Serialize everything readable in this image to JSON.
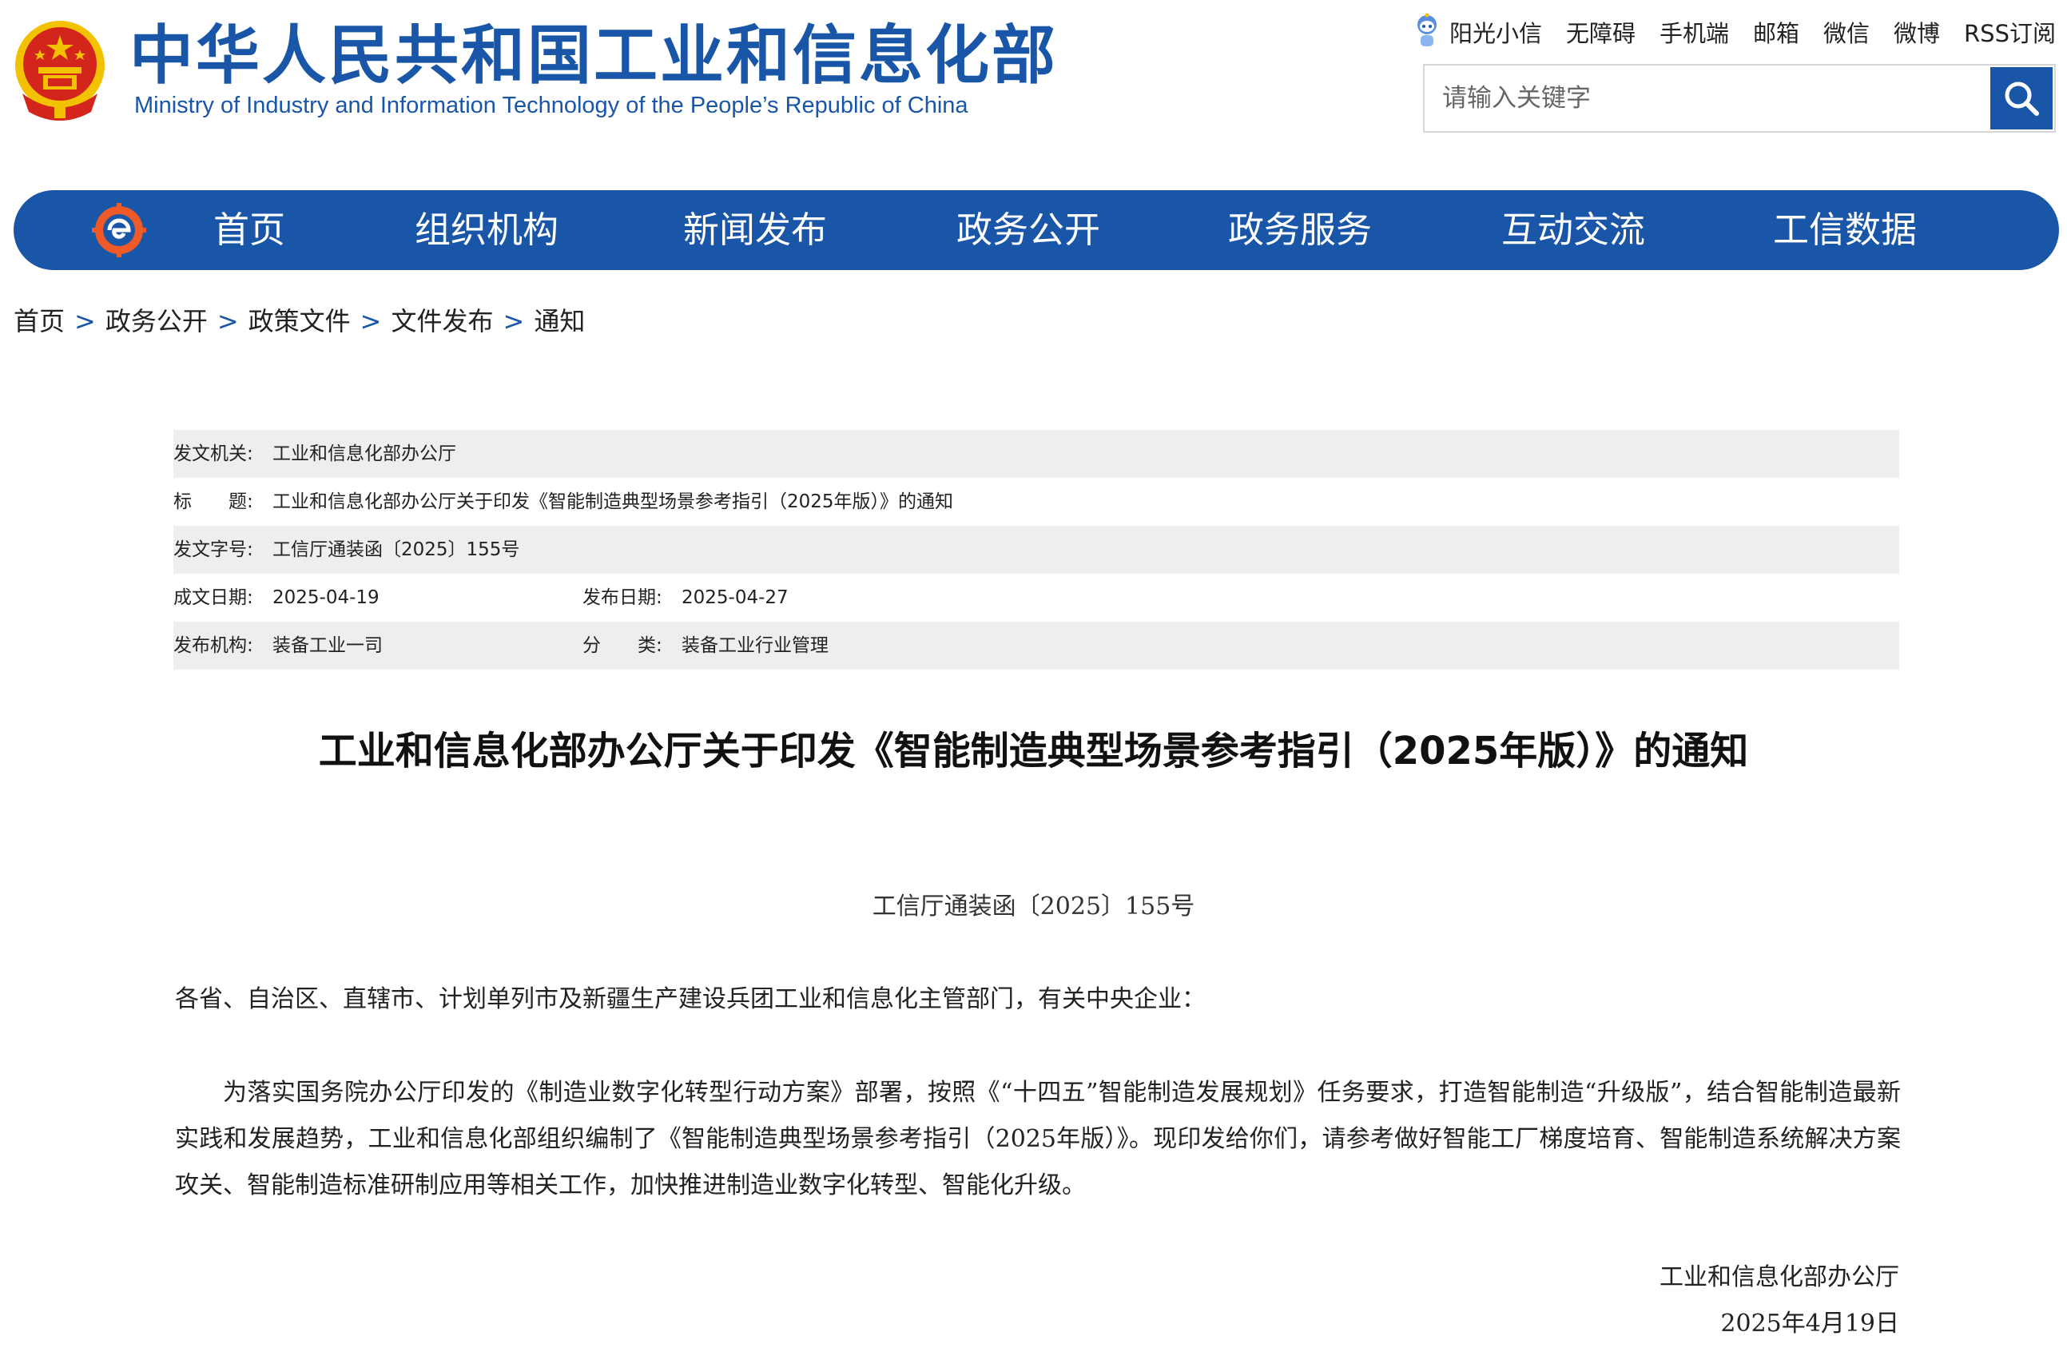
{
  "header": {
    "title_cn": "中华人民共和国工业和信息化部",
    "title_en": "Ministry of Industry and Information Technology of the People’s Republic of China",
    "top_links": [
      "阳光小信",
      "无障碍",
      "手机端",
      "邮箱",
      "微信",
      "微博",
      "RSS订阅"
    ],
    "search_placeholder": "请输入关键字"
  },
  "nav": {
    "items": [
      "首页",
      "组织机构",
      "新闻发布",
      "政务公开",
      "政务服务",
      "互动交流",
      "工信数据"
    ]
  },
  "breadcrumb": {
    "items": [
      "首页",
      "政务公开",
      "政策文件",
      "文件发布",
      "通知"
    ],
    "separator": ">"
  },
  "info": {
    "issuer_label": "发文机关:",
    "issuer": "工业和信息化部办公厅",
    "title_label": "标　　题:",
    "title": "工业和信息化部办公厅关于印发《智能制造典型场景参考指引（2025年版）》的通知",
    "doc_no_label": "发文字号:",
    "doc_no": "工信厅通装函〔2025〕155号",
    "created_label": "成文日期:",
    "created": "2025-04-19",
    "published_label": "发布日期:",
    "published": "2025-04-27",
    "org_label": "发布机构:",
    "org": "装备工业一司",
    "category_label": "分　　类:",
    "category": "装备工业行业管理"
  },
  "article": {
    "title": "工业和信息化部办公厅关于印发《智能制造典型场景参考指引（2025年版）》的通知",
    "doc_number": "工信厅通装函〔2025〕155号",
    "salutation": "各省、自治区、直辖市、计划单列市及新疆生产建设兵团工业和信息化主管部门，有关中央企业：",
    "body": "为落实国务院办公厅印发的《制造业数字化转型行动方案》部署，按照《“十四五”智能制造发展规划》任务要求，打造智能制造“升级版”，结合智能制造最新实践和发展趋势，工业和信息化部组织编制了《智能制造典型场景参考指引（2025年版）》。现印发给你们，请参考做好智能工厂梯度培育、智能制造系统解决方案攻关、智能制造标准研制应用等相关工作，加快推进制造业数字化转型、智能化升级。",
    "signature_org": "工业和信息化部办公厅",
    "signature_date": "2025年4月19日"
  },
  "colors": {
    "brand_blue": "#1a56a8",
    "emblem_red": "#d4251c",
    "emblem_gold": "#f2c100",
    "row_shade": "#eeeeee"
  },
  "icons": [
    "national-emblem-icon",
    "robot-mascot-icon",
    "search-icon",
    "nav-logo-icon"
  ]
}
